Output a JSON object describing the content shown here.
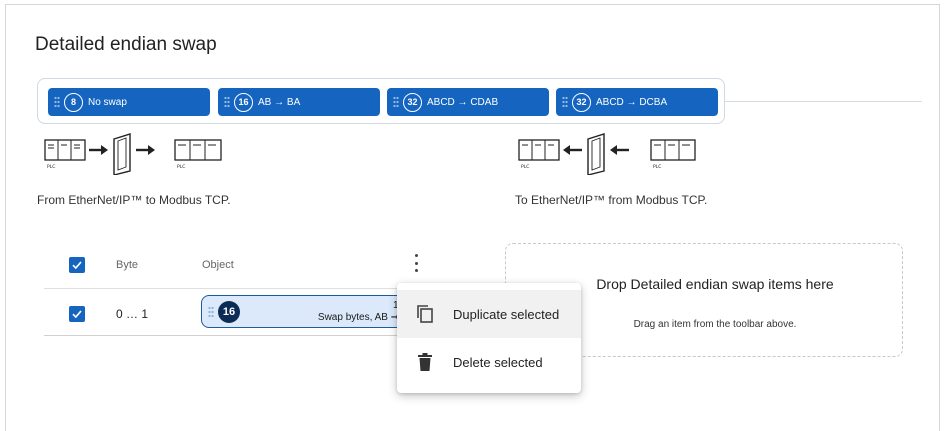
{
  "title": "Detailed endian swap",
  "toolbar": {
    "items": [
      {
        "badge": "8",
        "label": "No swap"
      },
      {
        "badge": "16",
        "label": "AB → BA"
      },
      {
        "badge": "32",
        "label": "ABCD → CDAB"
      },
      {
        "badge": "32",
        "label": "ABCD → DCBA"
      }
    ]
  },
  "diagrams": {
    "plc_label": "PLC",
    "left_caption": "From EtherNet/IP™ to Modbus TCP.",
    "right_caption": "To EtherNet/IP™ from Modbus TCP."
  },
  "table": {
    "headers": {
      "byte": "Byte",
      "object": "Object"
    },
    "rows": [
      {
        "byte": "0 … 1",
        "badge": "16",
        "line1": "16-bit",
        "line2": "Swap bytes, AB ➞ BA."
      }
    ]
  },
  "dropzone": {
    "title": "Drop Detailed endian swap items here",
    "subtitle": "Drag an item from the toolbar above."
  },
  "menu": {
    "duplicate": "Duplicate selected",
    "delete": "Delete selected"
  },
  "colors": {
    "primary": "#1565c0",
    "item_bg": "#dbe9fb",
    "item_border": "#1d5a9e",
    "badge_dark": "#0d2c55"
  }
}
